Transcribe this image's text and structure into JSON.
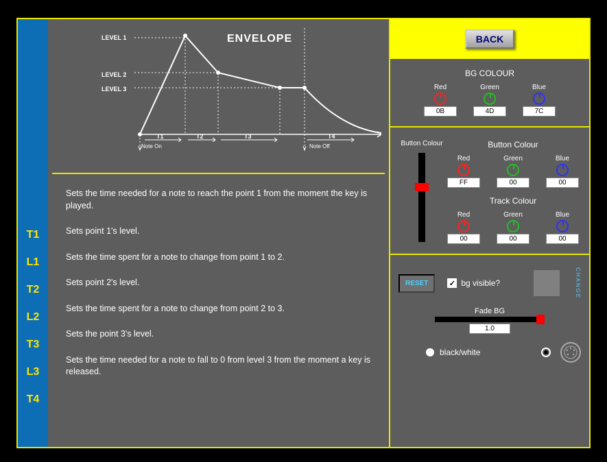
{
  "envelope": {
    "title": "ENVELOPE",
    "levels": [
      "LEVEL 1",
      "LEVEL 2",
      "LEVEL 3"
    ],
    "times": [
      "T1",
      "T2",
      "T3",
      "T4"
    ],
    "noteOn": "Note On",
    "noteOff": "Note Off"
  },
  "labels": [
    "T1",
    "L1",
    "T2",
    "L2",
    "T3",
    "L3",
    "T4"
  ],
  "descriptions": {
    "T1": "Sets the time needed for a note to reach the point 1 from the moment the key is played.",
    "L1": "Sets point 1's level.",
    "T2": "Sets the time spent for a note to change from  point 1 to 2.",
    "L2": "Sets point 2's level.",
    "T3": "Sets the time spent for a note to change from  point 2 to 3.",
    "L3": "Sets the point 3's level.",
    "T4": "Sets the time needed for a note to fall to 0 from  level 3 from the moment a key is released."
  },
  "back": "BACK",
  "bgColour": {
    "title": "BG COLOUR",
    "red": {
      "label": "Red",
      "value": "0B"
    },
    "green": {
      "label": "Green",
      "value": "4D"
    },
    "blue": {
      "label": "Blue",
      "value": "7C"
    }
  },
  "buttonColour": {
    "title": "Button Colour",
    "sliderLabel": "Button Colour",
    "red": {
      "label": "Red",
      "value": "FF"
    },
    "green": {
      "label": "Green",
      "value": "00"
    },
    "blue": {
      "label": "Blue",
      "value": "00"
    }
  },
  "trackColour": {
    "title": "Track Colour",
    "red": {
      "label": "Red",
      "value": "00"
    },
    "green": {
      "label": "Green",
      "value": "00"
    },
    "blue": {
      "label": "Blue",
      "value": "00"
    }
  },
  "reset": "RESET",
  "bgVisible": {
    "label": "bg visible?",
    "checked": true
  },
  "change": "CHANGE",
  "fadeBg": {
    "label": "Fade BG",
    "value": "1.0"
  },
  "blackWhite": "black/white"
}
